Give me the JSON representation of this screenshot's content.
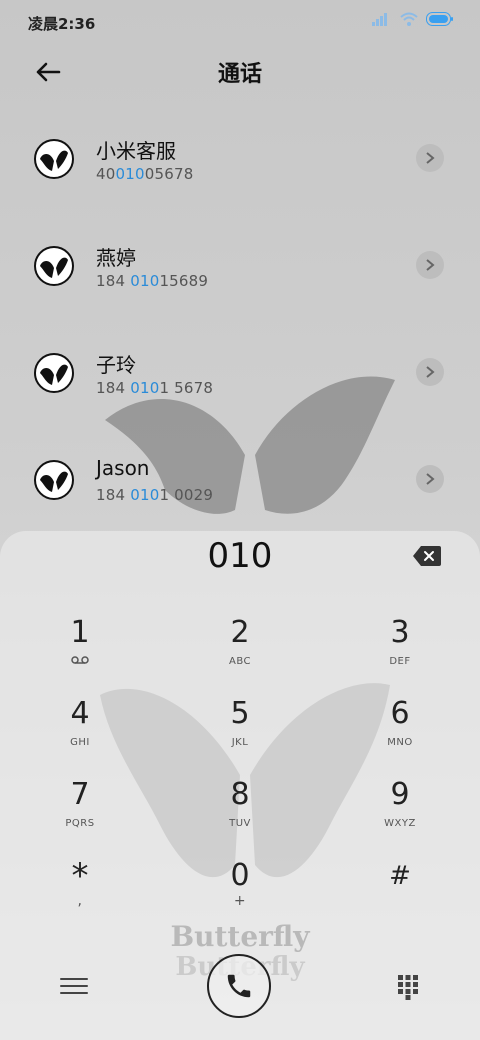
{
  "status": {
    "time": "凌晨2:36"
  },
  "header": {
    "title": "通话"
  },
  "contacts": [
    {
      "name": "小米客服",
      "number_pre": "40",
      "number_hl": "010",
      "number_post": "05678"
    },
    {
      "name": "燕婷",
      "number_pre": "184 ",
      "number_hl": "010",
      "number_post": "15689"
    },
    {
      "name": "子玲",
      "number_pre": "184 ",
      "number_hl": "010",
      "number_post": "1 5678"
    },
    {
      "name": "Jason",
      "number_pre": "184 ",
      "number_hl": "010",
      "number_post": "1 0029"
    }
  ],
  "dialpad": {
    "input": "010",
    "keys": [
      {
        "digit": "1",
        "letters": ""
      },
      {
        "digit": "2",
        "letters": "ABC"
      },
      {
        "digit": "3",
        "letters": "DEF"
      },
      {
        "digit": "4",
        "letters": "GHI"
      },
      {
        "digit": "5",
        "letters": "JKL"
      },
      {
        "digit": "6",
        "letters": "MNO"
      },
      {
        "digit": "7",
        "letters": "PQRS"
      },
      {
        "digit": "8",
        "letters": "TUV"
      },
      {
        "digit": "9",
        "letters": "WXYZ"
      },
      {
        "digit": "*",
        "letters": ","
      },
      {
        "digit": "0",
        "letters": "+"
      },
      {
        "digit": "#",
        "letters": ""
      }
    ]
  },
  "wallpaper": {
    "watermark": "Butterfly"
  },
  "colors": {
    "highlight": "#2a8bd8",
    "battery": "#3aa0f0"
  },
  "icons": {
    "back": "arrow-left-icon",
    "chevron": "chevron-right-icon",
    "backspace": "backspace-icon",
    "call": "phone-icon",
    "menu": "menu-icon",
    "keypad": "keypad-icon"
  }
}
